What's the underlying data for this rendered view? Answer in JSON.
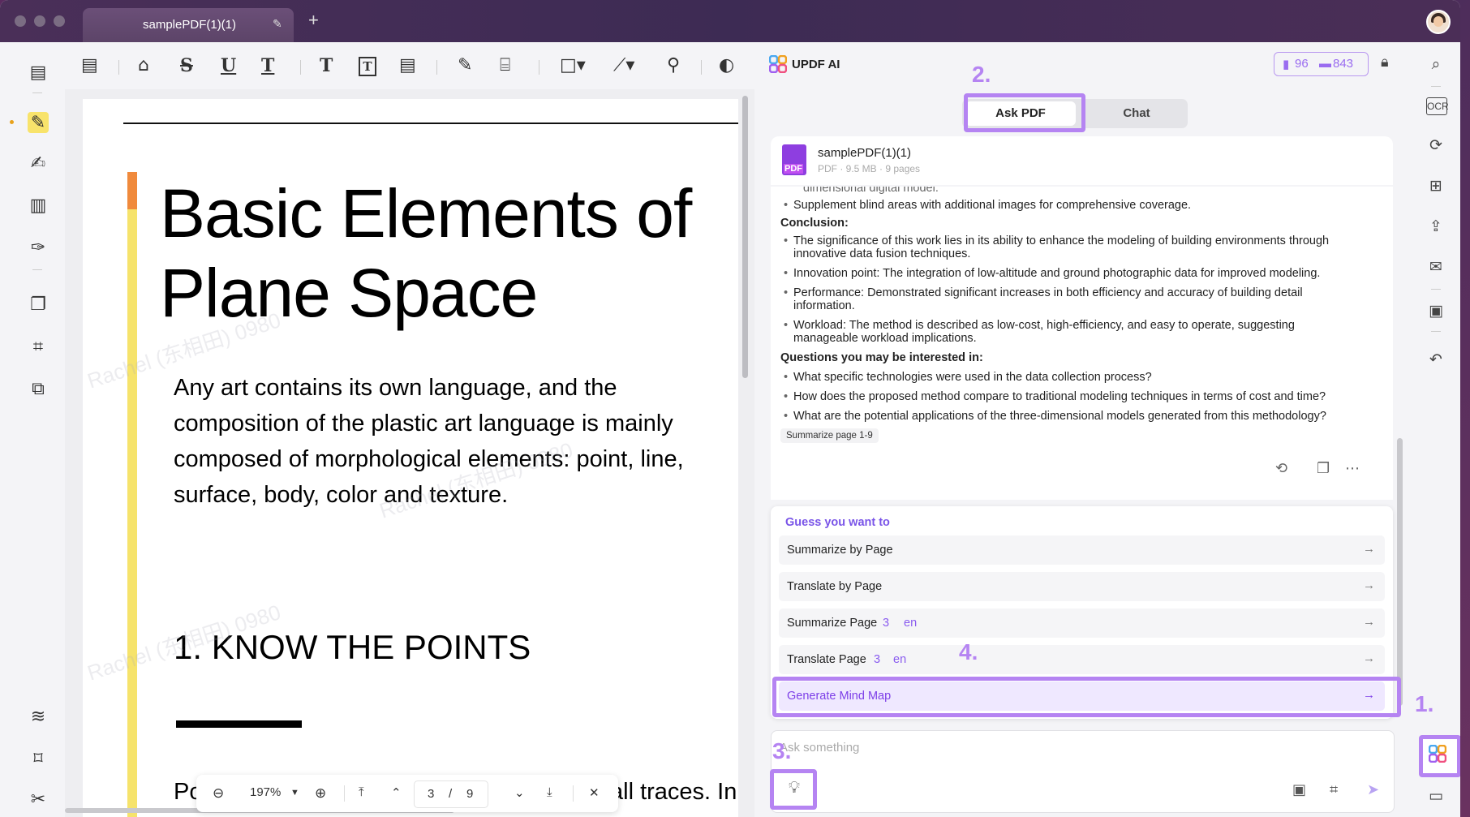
{
  "window": {
    "tab_title": "samplePDF(1)(1)",
    "new_tab": "+"
  },
  "toolbar": {
    "tools": [
      "comment",
      "pencil",
      "strikethrough",
      "underline",
      "squiggly",
      "text",
      "textbox",
      "textcallout",
      "pen",
      "eraser",
      "shape",
      "line",
      "attachment",
      "stamp"
    ]
  },
  "document": {
    "heading": "Basic Elements of Plane Space",
    "paragraph": "Any art contains its own language, and the composition of the plastic art language is mainly composed of morphological elements: point, line, surface, body, color and texture.",
    "section": "1. KNOW THE POINTS",
    "bottom_left": "Po",
    "bottom_right": "all traces. In",
    "watermark": "Rachel (东相田) 0980"
  },
  "zoom": {
    "level": "197%",
    "current_page": "3",
    "separator": "/",
    "total_pages": "9"
  },
  "ai": {
    "title": "UPDF AI",
    "credits_pdf": "96",
    "credits_chat": "843",
    "tab_ask": "Ask PDF",
    "tab_chat": "Chat",
    "file_name": "samplePDF(1)(1)",
    "file_meta": "PDF · 9.5 MB · 9 pages",
    "answer": {
      "cut_line": "dimensional digital model.",
      "b1": "Supplement blind areas with additional images for comprehensive coverage.",
      "conclusion": "Conclusion:",
      "c1a": "The significance of this work lies in its ability to enhance the modeling of building environments through",
      "c1b": "innovative data fusion techniques.",
      "c2": "Innovation point: The integration of low-altitude and ground photographic data for improved modeling.",
      "c3a": "Performance: Demonstrated significant increases in both efficiency and accuracy of building detail",
      "c3b": "information.",
      "c4a": "Workload: The method is described as low-cost, high-efficiency, and easy to operate, suggesting",
      "c4b": "manageable workload implications.",
      "questions": "Questions you may be interested in:",
      "q1": "What specific technologies were used in the data collection process?",
      "q2": "How does the proposed method compare to traditional modeling techniques in terms of cost and time?",
      "q3": "What are the potential applications of the three-dimensional models generated from this methodology?",
      "chip": "Summarize page 1-9"
    },
    "guess": {
      "title": "Guess you want to",
      "items": [
        {
          "label": "Summarize by Page"
        },
        {
          "label": "Translate by Page"
        },
        {
          "label": "Summarize Page",
          "page": "3",
          "lang": "en"
        },
        {
          "label": "Translate Page",
          "page": "3",
          "lang": "en"
        },
        {
          "label": "Generate Mind Map"
        }
      ]
    },
    "input_placeholder": "Ask something"
  },
  "steps": [
    "1.",
    "2.",
    "3.",
    "4."
  ],
  "colors": {
    "accent": "#b584f2",
    "highlight_yellow": "#f6e36b",
    "orange": "#f08a3c"
  }
}
